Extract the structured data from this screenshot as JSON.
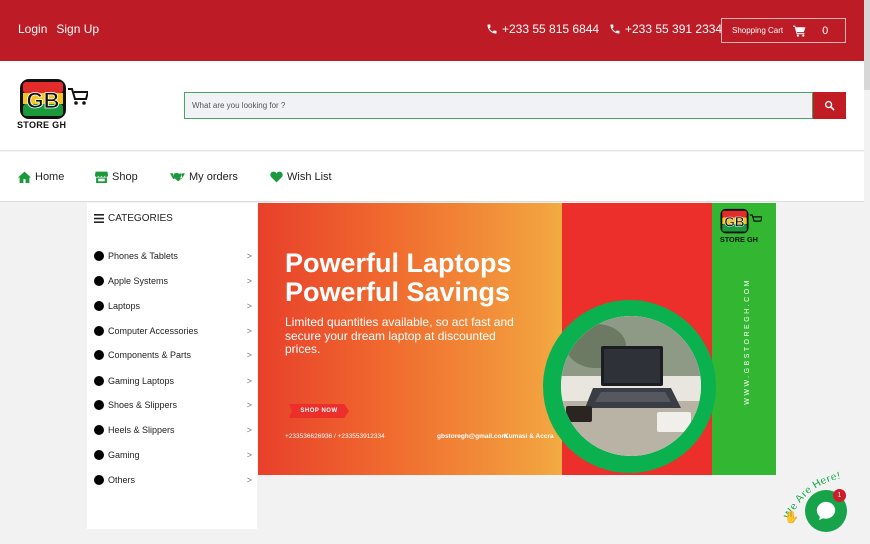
{
  "topbar": {
    "login": "Login",
    "signup": "Sign Up",
    "phone1": "+233 55 815 6844",
    "phone2": "+233 55 391 2334",
    "cart_label": "Shopping Cart",
    "cart_count": "0",
    "bg_color": "#bd1b26"
  },
  "header": {
    "logo_text": "GB",
    "logo_sub": "STORE GH",
    "search_placeholder": "What are you looking for ?"
  },
  "nav": {
    "items": [
      {
        "label": "Home",
        "icon": "home-icon"
      },
      {
        "label": "Shop",
        "icon": "store-icon"
      },
      {
        "label": "My orders",
        "icon": "handshake-icon"
      },
      {
        "label": "Wish List",
        "icon": "heart-icon"
      }
    ]
  },
  "sidebar": {
    "title": "CATEGORIES",
    "categories": [
      "Phones & Tablets",
      "Apple Systems",
      "Laptops",
      "Computer Accessories",
      "Components & Parts",
      "Gaming Laptops",
      "Shoes & Slippers",
      "Heels & Slippers",
      "Gaming",
      "Others"
    ],
    "arrow": ">"
  },
  "banner": {
    "headline_1": "Powerful Laptops",
    "headline_2": "Powerful Savings",
    "description": "Limited quantities available, so act fast and secure your dream laptop at discounted prices.",
    "cta": "SHOP NOW",
    "phones": "+233536626936 / +233553912334",
    "email": "gbstoregh@gmail.com",
    "locations": "Kumasi & Accra",
    "website": "WWW.GBSTOREGH.COM",
    "logo_text": "GB",
    "logo_sub": "STORE GH"
  },
  "chat": {
    "label": "We Are Here!",
    "badge": "1",
    "color": "#17a34a"
  }
}
